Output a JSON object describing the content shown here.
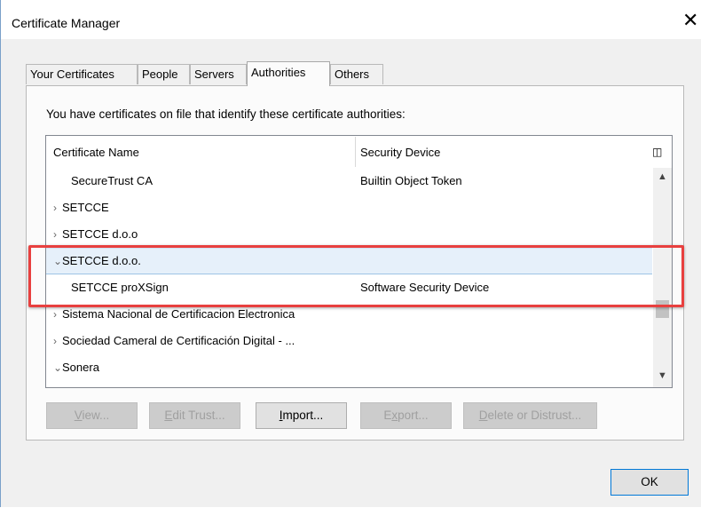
{
  "window": {
    "title": "Certificate Manager",
    "close_glyph": "✕"
  },
  "tabs": [
    {
      "label": "Your Certificates",
      "active": false
    },
    {
      "label": "People",
      "active": false
    },
    {
      "label": "Servers",
      "active": false
    },
    {
      "label": "Authorities",
      "active": true
    },
    {
      "label": "Others",
      "active": false
    }
  ],
  "panel": {
    "intro": "You have certificates on file that identify these certificate authorities:",
    "columns": {
      "name": "Certificate Name",
      "device": "Security Device"
    },
    "column_picker_icon": "column-picker-icon",
    "rows": [
      {
        "twisty": "",
        "name": "SecureTrust CA",
        "device": "Builtin Object Token",
        "child": true
      },
      {
        "twisty": "›",
        "name": "SETCCE",
        "device": "",
        "child": false
      },
      {
        "twisty": "›",
        "name": "SETCCE d.o.o",
        "device": "",
        "child": false
      },
      {
        "twisty": "⌄",
        "name": "SETCCE d.o.o.",
        "device": "",
        "child": false,
        "selected": true
      },
      {
        "twisty": "",
        "name": "SETCCE proXSign",
        "device": "Software Security Device",
        "child": true
      },
      {
        "twisty": "›",
        "name": "Sistema Nacional de Certificacion Electronica",
        "device": "",
        "child": false
      },
      {
        "twisty": "›",
        "name": "Sociedad Cameral de Certificación Digital - ...",
        "device": "",
        "child": false
      },
      {
        "twisty": "⌄",
        "name": "Sonera",
        "device": "",
        "child": false
      }
    ],
    "buttons": {
      "view": {
        "underline": "V",
        "rest": "iew..."
      },
      "edit_trust": {
        "underline": "E",
        "rest": "dit Trust..."
      },
      "import": {
        "underline": "I",
        "rest": "mport..."
      },
      "export": {
        "underline": "x",
        "pre": "E",
        "rest": "port..."
      },
      "delete": {
        "underline": "D",
        "rest": "elete or Distrust..."
      }
    }
  },
  "footer": {
    "ok_label": "OK"
  },
  "colors": {
    "highlight": "#e8403f",
    "selected_row": "#e6f0fa",
    "ok_border": "#0078d7"
  }
}
